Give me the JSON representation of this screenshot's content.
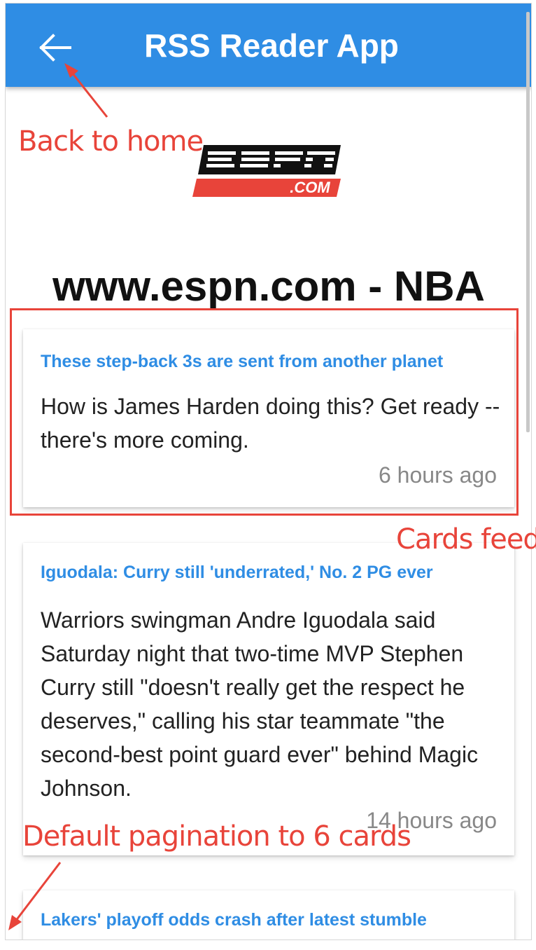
{
  "appbar": {
    "title": "RSS Reader App",
    "back_icon": "arrow-left-icon",
    "color": "#2f8de4"
  },
  "logo": {
    "text_main": "ESPN",
    "text_sub": ".COM",
    "color": "#e8443a"
  },
  "feed": {
    "title": "www.espn.com - NBA"
  },
  "cards": [
    {
      "title": "These step-back 3s are sent from another planet",
      "description": "How is James Harden doing this? Get ready -- there's more coming.",
      "time": "6 hours ago"
    },
    {
      "title": "Iguodala: Curry still 'underrated,' No. 2 PG ever",
      "description": "Warriors swingman Andre Iguodala said Saturday night that two-time MVP Stephen Curry still \"doesn't really get the respect he deserves,\" calling his star teammate \"the second-best point guard ever\" behind Magic Johnson.",
      "time": "14 hours ago"
    },
    {
      "title": "Lakers' playoff odds crash after latest stumble"
    }
  ],
  "annotations": {
    "back_to_home": "Back to home",
    "cards_feed": "Cards feed",
    "pagination": "Default pagination to 6 cards",
    "color": "#e8443a"
  }
}
